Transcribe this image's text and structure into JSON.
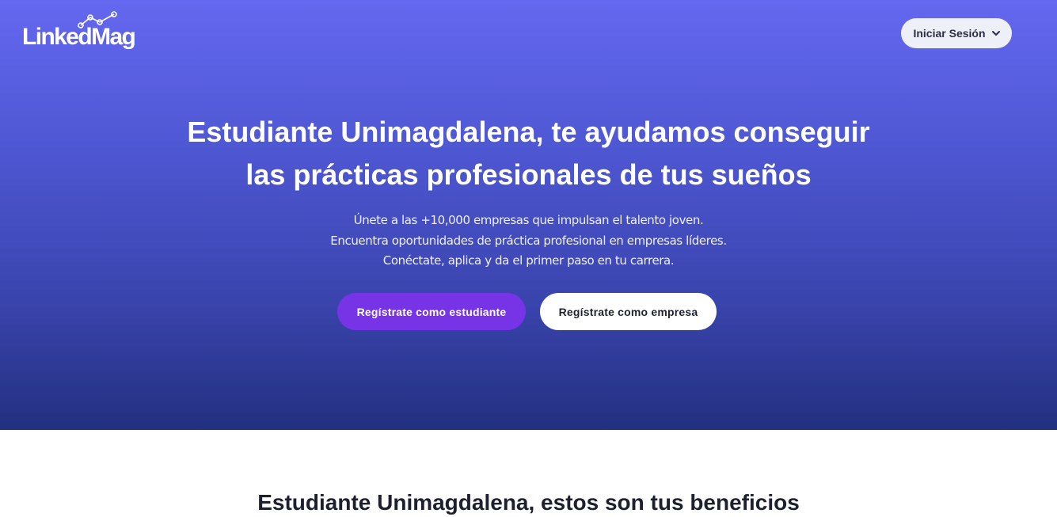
{
  "header": {
    "logo_text": "LinkedMag",
    "logo_icon": "trend-line-icon",
    "login_label": "Iniciar Sesión",
    "login_icon": "chevron-down-icon"
  },
  "hero": {
    "headline_lines": [
      "Estudiante Unimagdalena, te ayudamos conseguir",
      "las prácticas profesionales de tus sueños"
    ],
    "sub_lines": [
      "Únete a las +10,000 empresas que impulsan el talento joven.",
      "Encuentra oportunidades de práctica profesional en empresas líderes.",
      "Conéctate, aplica y da el primer paso en tu carrera."
    ],
    "cta_student": "Regístrate como estudiante",
    "cta_company": "Regístrate como empresa"
  },
  "benefits": {
    "title": "Estudiante Unimagdalena, estos son tus beneficios"
  },
  "colors": {
    "hero_top": "#6468f0",
    "hero_bottom": "#22307f",
    "accent_purple": "#7734e6"
  }
}
